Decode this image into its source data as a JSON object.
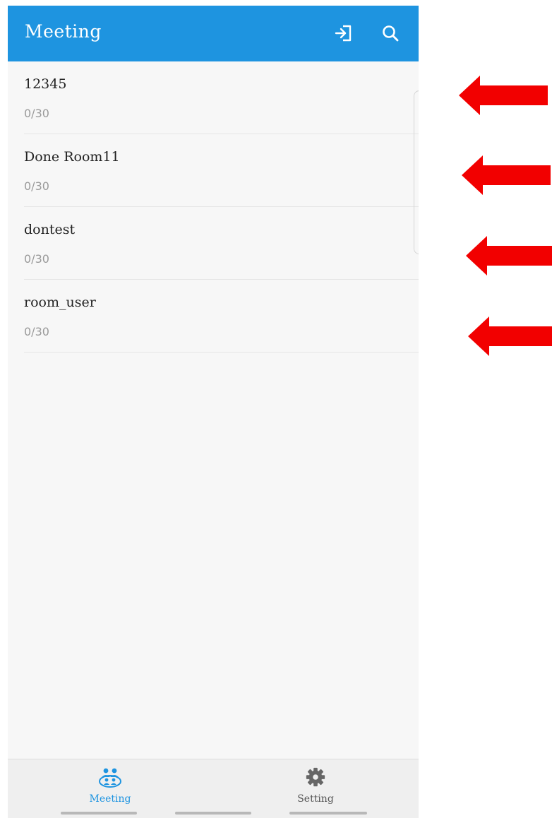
{
  "app": {
    "title": "Meeting"
  },
  "header": {
    "icons": [
      "join-room-icon",
      "search-icon"
    ]
  },
  "rooms": [
    {
      "name": "12345",
      "count": "0/30"
    },
    {
      "name": "Done Room11",
      "count": "0/30"
    },
    {
      "name": "dontest",
      "count": "0/30"
    },
    {
      "name": "room_user",
      "count": "0/30"
    }
  ],
  "bottom_nav": {
    "items": [
      {
        "label": "Meeting",
        "icon": "meeting-group-icon",
        "active": true
      },
      {
        "label": "Setting",
        "icon": "gear-icon",
        "active": false
      }
    ]
  },
  "colors": {
    "primary": "#1e94e0",
    "annotation_arrow": "#f20000",
    "list_background": "#f7f7f7"
  }
}
